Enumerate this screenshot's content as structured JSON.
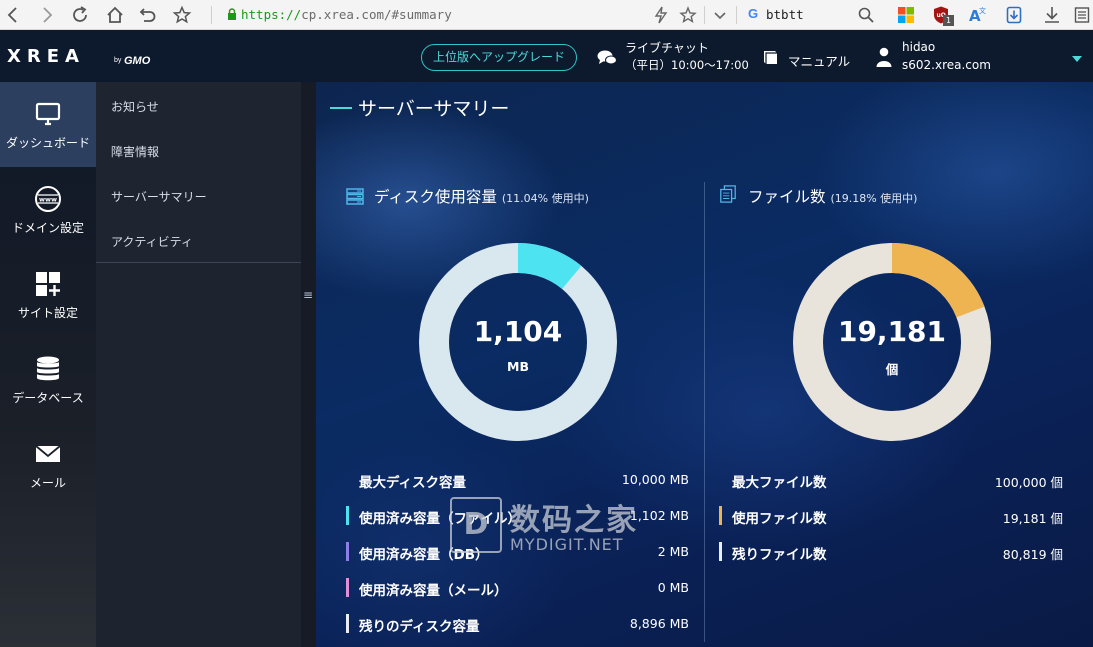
{
  "browser": {
    "url_scheme": "https://",
    "url_rest": "cp.xrea.com/#summary",
    "search_query": "btbtt",
    "extension_badge": "1"
  },
  "header": {
    "logo": "XREA",
    "logo_by": "by",
    "logo_gmo": "GMO",
    "upgrade_label": "上位版へアップグレード",
    "chat_title": "ライブチャット",
    "chat_hours": "（平日）10:00〜17:00",
    "manual_label": "マニュアル",
    "user_name": "hidao",
    "user_server": "s602.xrea.com"
  },
  "rail": {
    "items": [
      {
        "label": "ダッシュボード",
        "icon": "monitor-icon"
      },
      {
        "label": "ドメイン設定",
        "icon": "www-globe-icon"
      },
      {
        "label": "サイト設定",
        "icon": "grid-plus-icon"
      },
      {
        "label": "データベース",
        "icon": "database-icon"
      },
      {
        "label": "メール",
        "icon": "mail-icon"
      }
    ]
  },
  "submenu": {
    "items": [
      {
        "label": "お知らせ"
      },
      {
        "label": "障害情報"
      },
      {
        "label": "サーバーサマリー"
      },
      {
        "label": "アクティビティ"
      }
    ],
    "collapse_glyph": "≡"
  },
  "main": {
    "title": "サーバーサマリー"
  },
  "disk": {
    "title": "ディスク使用容量",
    "usage_note": "(11.04% 使用中)",
    "used_percent": 11.04,
    "value": "1,104",
    "unit": "MB",
    "colors": {
      "used": "#4de3f0",
      "rest": "#d9e7ef"
    },
    "stats": [
      {
        "label": "最大ディスク容量",
        "value": "10,000 MB",
        "bar_color": ""
      },
      {
        "label": "使用済み容量（ファイル）",
        "value": "1,102 MB",
        "bar_color": "#4de3f0"
      },
      {
        "label": "使用済み容量（DB）",
        "value": "2 MB",
        "bar_color": "#8f7ee8"
      },
      {
        "label": "使用済み容量（メール）",
        "value": "0 MB",
        "bar_color": "#e08fd8"
      },
      {
        "label": "残りのディスク容量",
        "value": "8,896 MB",
        "bar_color": "#e9eef4"
      }
    ]
  },
  "files": {
    "title": "ファイル数",
    "usage_note": "(19.18% 使用中)",
    "used_percent": 19.18,
    "value": "19,181",
    "unit": "個",
    "colors": {
      "used": "#eeb452",
      "rest": "#e8e4dc"
    },
    "stats": [
      {
        "label": "最大ファイル数",
        "value": "100,000 個",
        "bar_color": ""
      },
      {
        "label": "使用ファイル数",
        "value": "19,181 個",
        "bar_color": "#eeb452"
      },
      {
        "label": "残りファイル数",
        "value": "80,819 個",
        "bar_color": "#e9eef4"
      }
    ]
  },
  "watermark": {
    "box_glyph": "D",
    "cn": "数码之家",
    "en": "MYDIGIT.NET"
  }
}
